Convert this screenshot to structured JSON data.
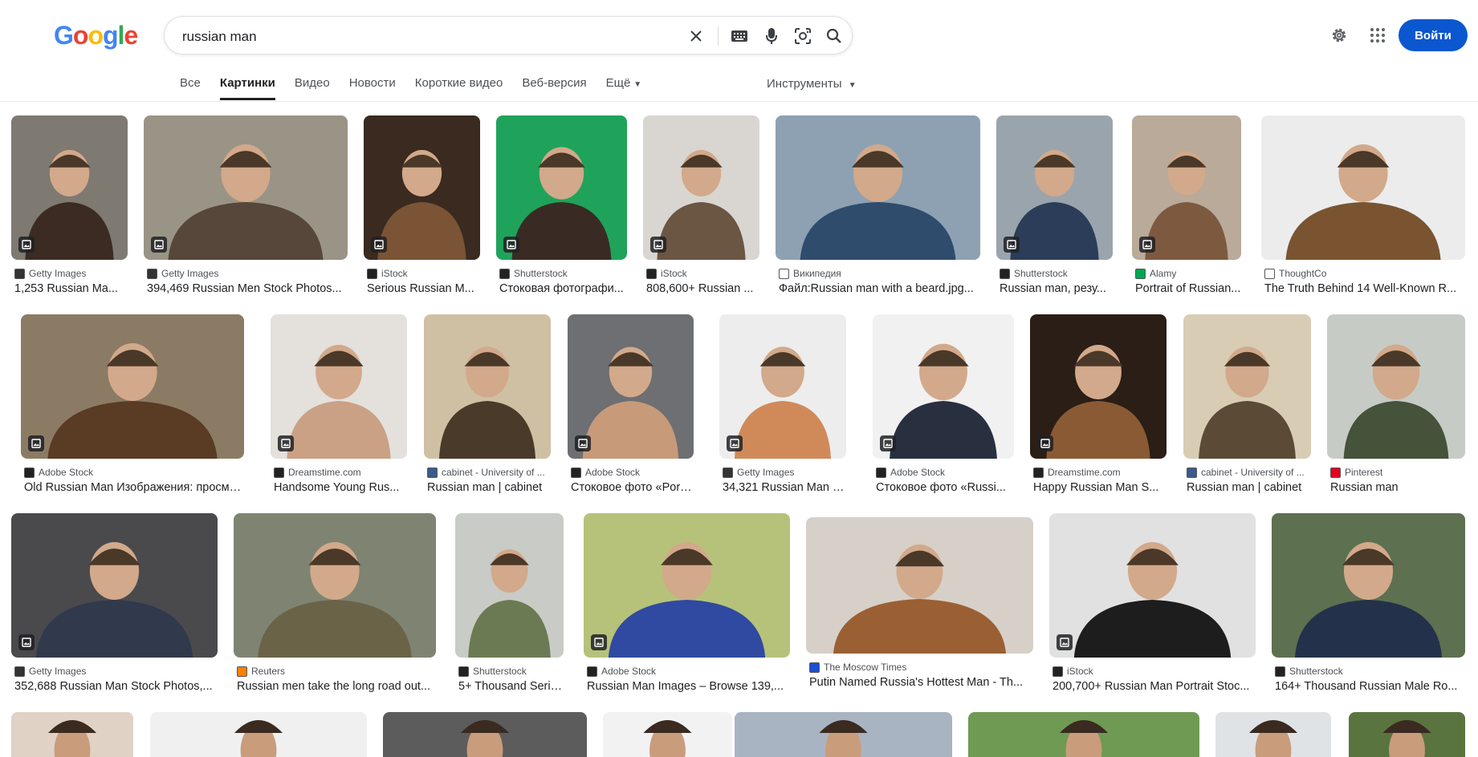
{
  "header": {
    "logo_letters": [
      {
        "ch": "G",
        "color": "#4285f4"
      },
      {
        "ch": "o",
        "color": "#ea4335"
      },
      {
        "ch": "o",
        "color": "#fbbc05"
      },
      {
        "ch": "g",
        "color": "#4285f4"
      },
      {
        "ch": "l",
        "color": "#34a853"
      },
      {
        "ch": "e",
        "color": "#ea4335"
      }
    ],
    "search_value": "russian man",
    "login_label": "Войти"
  },
  "tabs": [
    {
      "label": "Все",
      "active": false
    },
    {
      "label": "Картинки",
      "active": true
    },
    {
      "label": "Видео",
      "active": false
    },
    {
      "label": "Новости",
      "active": false
    },
    {
      "label": "Короткие видео",
      "active": false
    },
    {
      "label": "Веб-версия",
      "active": false
    },
    {
      "label": "Ещё",
      "active": false
    }
  ],
  "tools_label": "Инструменты",
  "results": [
    {
      "source": "Getty Images",
      "title": "1,253 Russian Ma...",
      "fav": "#333333"
    },
    {
      "source": "Getty Images",
      "title": "394,469 Russian Men Stock Photos...",
      "fav": "#333333"
    },
    {
      "source": "iStock",
      "title": "Serious Russian M...",
      "fav": "#222222"
    },
    {
      "source": "Shutterstock",
      "title": "Стоковая фотографи...",
      "fav": "#222222"
    },
    {
      "source": "iStock",
      "title": "808,600+ Russian ...",
      "fav": "#222222"
    },
    {
      "source": "Википедия",
      "title": "Файл:Russian man with a beard.jpg...",
      "fav": "#ffffff"
    },
    {
      "source": "Shutterstock",
      "title": "Russian man, резу...",
      "fav": "#222222"
    },
    {
      "source": "Alamy",
      "title": "Portrait of Russian...",
      "fav": "#00a651"
    },
    {
      "source": "ThoughtCo",
      "title": "The Truth Behind 14 Well-Known R...",
      "fav": "#ffffff"
    },
    {
      "source": "Adobe Stock",
      "title": "Old Russian Man Изображения: просматр...",
      "fav": "#222222"
    },
    {
      "source": "Dreamstime.com",
      "title": "Handsome Young Rus...",
      "fav": "#222222"
    },
    {
      "source": "cabinet - University of ...",
      "title": "Russian man | cabinet",
      "fav": "#3b5b8a"
    },
    {
      "source": "Adobe Stock",
      "title": "Стоковое фото «Portr...",
      "fav": "#222222"
    },
    {
      "source": "Getty Images",
      "title": "34,321 Russian Man P...",
      "fav": "#333333"
    },
    {
      "source": "Adobe Stock",
      "title": "Стоковое фото «Russi...",
      "fav": "#222222"
    },
    {
      "source": "Dreamstime.com",
      "title": "Happy Russian Man S...",
      "fav": "#222222"
    },
    {
      "source": "cabinet - University of ...",
      "title": "Russian man | cabinet",
      "fav": "#3b5b8a"
    },
    {
      "source": "Pinterest",
      "title": "Russian man",
      "fav": "#e60023"
    },
    {
      "source": "Getty Images",
      "title": "352,688 Russian Man Stock Photos,...",
      "fav": "#333333"
    },
    {
      "source": "Reuters",
      "title": "Russian men take the long road out...",
      "fav": "#ff8000"
    },
    {
      "source": "Shutterstock",
      "title": "5+ Thousand Serio...",
      "fav": "#222222"
    },
    {
      "source": "Adobe Stock",
      "title": "Russian Man Images – Browse 139,...",
      "fav": "#222222"
    },
    {
      "source": "The Moscow Times",
      "title": "Putin Named Russia's Hottest Man - Th...",
      "fav": "#1a4fd6"
    },
    {
      "source": "iStock",
      "title": "200,700+ Russian Man Portrait Stoc...",
      "fav": "#222222"
    },
    {
      "source": "Shutterstock",
      "title": "164+ Thousand Russian Male Ro...",
      "fav": "#222222"
    }
  ],
  "colors": {
    "accent": "#0b57d0"
  }
}
